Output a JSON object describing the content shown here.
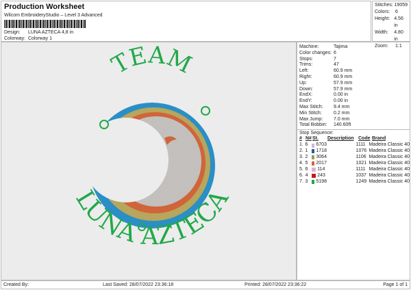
{
  "header": {
    "title": "Production Worksheet",
    "subtitle": "Wilcom EmbroideryStudio – Level 3 Advanced",
    "design_label": "Design:",
    "design": "LUNA AZTECA 4,8 in",
    "colorway_label": "Colorway:",
    "colorway": "Colorway 1"
  },
  "stats": [
    {
      "k": "Stitches:",
      "v": "19059"
    },
    {
      "k": "Colors:",
      "v": "6"
    },
    {
      "k": "Height:",
      "v": "4.56 in"
    },
    {
      "k": "Width:",
      "v": "4.80 in"
    },
    {
      "k": "Zoom:",
      "v": "1:1"
    }
  ],
  "design_art": {
    "top_text": "TEAM",
    "bottom_text": "LUNA AZTECA"
  },
  "info": [
    {
      "k": "Machine:",
      "v": "Tajima"
    },
    {
      "k": "Color changes:",
      "v": "6"
    },
    {
      "k": "Stops:",
      "v": "7"
    },
    {
      "k": "Trims:",
      "v": "47"
    },
    {
      "k": "Left:",
      "v": "60.9 mm"
    },
    {
      "k": "Right:",
      "v": "60.9 mm"
    },
    {
      "k": "Up:",
      "v": "57.9 mm"
    },
    {
      "k": "Down:",
      "v": "57.9 mm"
    },
    {
      "k": "EndX:",
      "v": "0.00 in"
    },
    {
      "k": "EndY:",
      "v": "0.00 in"
    },
    {
      "k": "Max Stitch:",
      "v": "9.4 mm"
    },
    {
      "k": "Min Stitch:",
      "v": "0.2 mm"
    },
    {
      "k": "Max Jump:",
      "v": "7.0 mm"
    },
    {
      "k": "Total Bobbin:",
      "v": "140.60ft"
    }
  ],
  "stop_sequence": {
    "label": "Stop Sequence:",
    "headers": [
      "#",
      "N#",
      "St.",
      "Description",
      "Code",
      "Brand"
    ],
    "rows": [
      {
        "n": "1.",
        "nn": "6",
        "color": "#d8b4d4",
        "st": "6703",
        "desc": "",
        "code": "1111",
        "brand": "Madeira Classic 40"
      },
      {
        "n": "2.",
        "nn": "1",
        "color": "#1e5fa8",
        "st": "1718",
        "desc": "",
        "code": "1076",
        "brand": "Madeira Classic 40"
      },
      {
        "n": "3.",
        "nn": "2",
        "color": "#a49660",
        "st": "3064",
        "desc": "",
        "code": "1106",
        "brand": "Madeira Classic 40"
      },
      {
        "n": "4.",
        "nn": "5",
        "color": "#d0643a",
        "st": "2017",
        "desc": "",
        "code": "1021",
        "brand": "Madeira Classic 40"
      },
      {
        "n": "5.",
        "nn": "6",
        "color": "#d8b4d4",
        "st": "114",
        "desc": "",
        "code": "1111",
        "brand": "Madeira Classic 40"
      },
      {
        "n": "6.",
        "nn": "4",
        "color": "#c41a24",
        "st": "243",
        "desc": "",
        "code": "1037",
        "brand": "Madeira Classic 40"
      },
      {
        "n": "7.",
        "nn": "3",
        "color": "#22a84a",
        "st": "5198",
        "desc": "",
        "code": "1249",
        "brand": "Madeira Classic 40"
      }
    ]
  },
  "footer": {
    "created": "Created By:",
    "saved": "Last Saved: 28/07/2022 23:36:18",
    "printed": "Printed: 28/07/2022 23:36:22",
    "page": "Page 1 of 1"
  }
}
